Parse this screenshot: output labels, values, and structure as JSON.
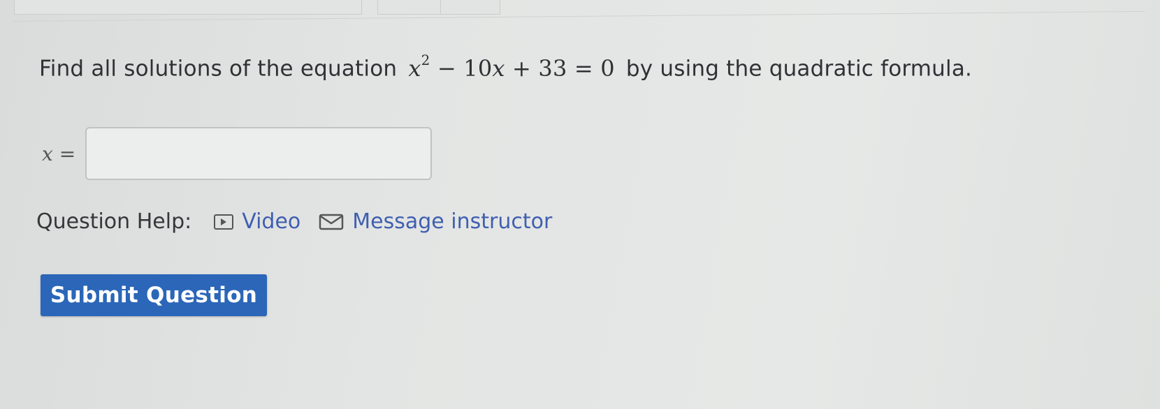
{
  "question": {
    "prefix": "Find all solutions of the equation",
    "equation": {
      "var": "x",
      "exponent": "2",
      "middle": "− 10",
      "var2": "x",
      "tail": "+ 33 = 0"
    },
    "suffix": "by using the quadratic formula."
  },
  "answer": {
    "label_var": "x",
    "label_eq": "=",
    "value": "",
    "placeholder": ""
  },
  "help": {
    "label": "Question Help:",
    "video_label": "Video",
    "message_label": "Message instructor"
  },
  "submit": {
    "label": "Submit Question"
  },
  "colors": {
    "accent": "#2b66b8",
    "link": "#3f5fb0",
    "text": "#2f3234",
    "background": "#e3e5e4"
  }
}
